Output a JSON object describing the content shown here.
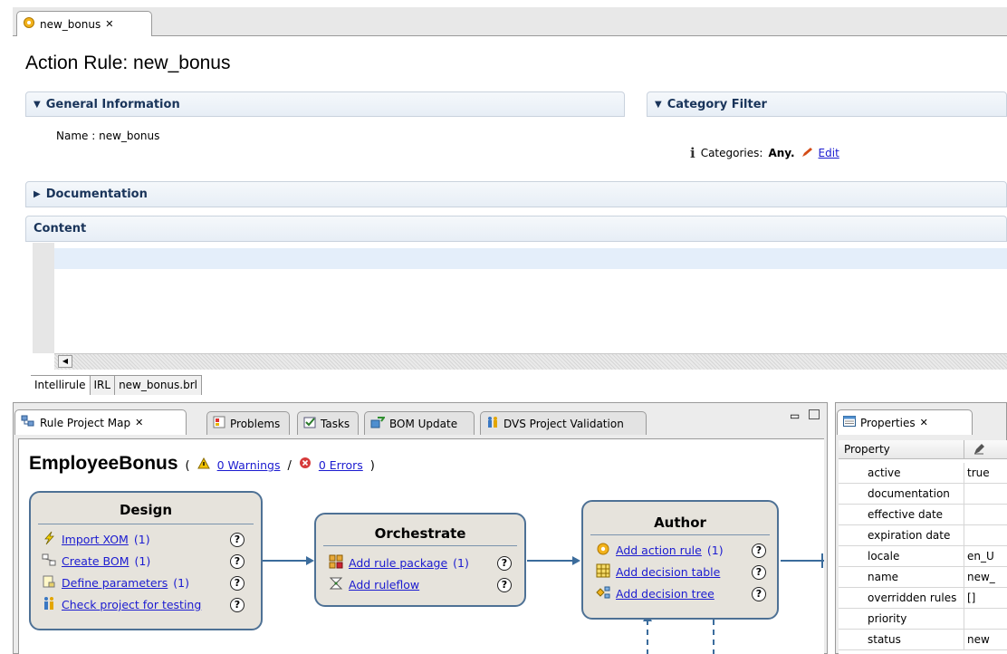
{
  "editor": {
    "tab_label": "new_bonus",
    "title": "Action Rule: new_bonus",
    "general_info": {
      "heading": "General Information",
      "name_label": "Name :",
      "name_value": "new_bonus"
    },
    "category_filter": {
      "heading": "Category Filter",
      "categories_label": "Categories:",
      "categories_value": "Any.",
      "edit_label": "Edit"
    },
    "documentation_heading": "Documentation",
    "content_heading": "Content",
    "bottom_tabs": [
      "Intellirule",
      "IRL",
      "new_bonus.brl"
    ]
  },
  "bottom_panel": {
    "tabs": [
      "Rule Project Map",
      "Problems",
      "Tasks",
      "BOM Update",
      "DVS Project Validation"
    ],
    "project_name": "EmployeeBonus",
    "warnings_label": "0 Warnings",
    "errors_label": "0 Errors",
    "boxes": {
      "design": {
        "title": "Design",
        "items": [
          {
            "label": "Import XOM",
            "count": "(1)"
          },
          {
            "label": "Create BOM",
            "count": "(1)"
          },
          {
            "label": "Define parameters",
            "count": "(1)"
          },
          {
            "label": "Check project for testing",
            "count": ""
          }
        ]
      },
      "orchestrate": {
        "title": "Orchestrate",
        "items": [
          {
            "label": "Add rule package",
            "count": "(1)"
          },
          {
            "label": "Add ruleflow",
            "count": ""
          }
        ]
      },
      "author": {
        "title": "Author",
        "items": [
          {
            "label": "Add action rule",
            "count": "(1)"
          },
          {
            "label": "Add decision table",
            "count": ""
          },
          {
            "label": "Add decision tree",
            "count": ""
          }
        ]
      }
    }
  },
  "properties": {
    "tab_label": "Properties",
    "header": "Property",
    "rows": [
      {
        "key": "active",
        "value": "true"
      },
      {
        "key": "documentation",
        "value": ""
      },
      {
        "key": "effective date",
        "value": ""
      },
      {
        "key": "expiration date",
        "value": ""
      },
      {
        "key": "locale",
        "value": "en_U"
      },
      {
        "key": "name",
        "value": "new_"
      },
      {
        "key": "overridden rules",
        "value": "[]"
      },
      {
        "key": "priority",
        "value": ""
      },
      {
        "key": "status",
        "value": "new"
      }
    ]
  },
  "colors": {
    "link": "#1b1bd0",
    "section_text": "#19345a",
    "box_border": "#4e7195",
    "box_bg": "#e6e3dc",
    "content_highlight": "#e4eefa"
  }
}
